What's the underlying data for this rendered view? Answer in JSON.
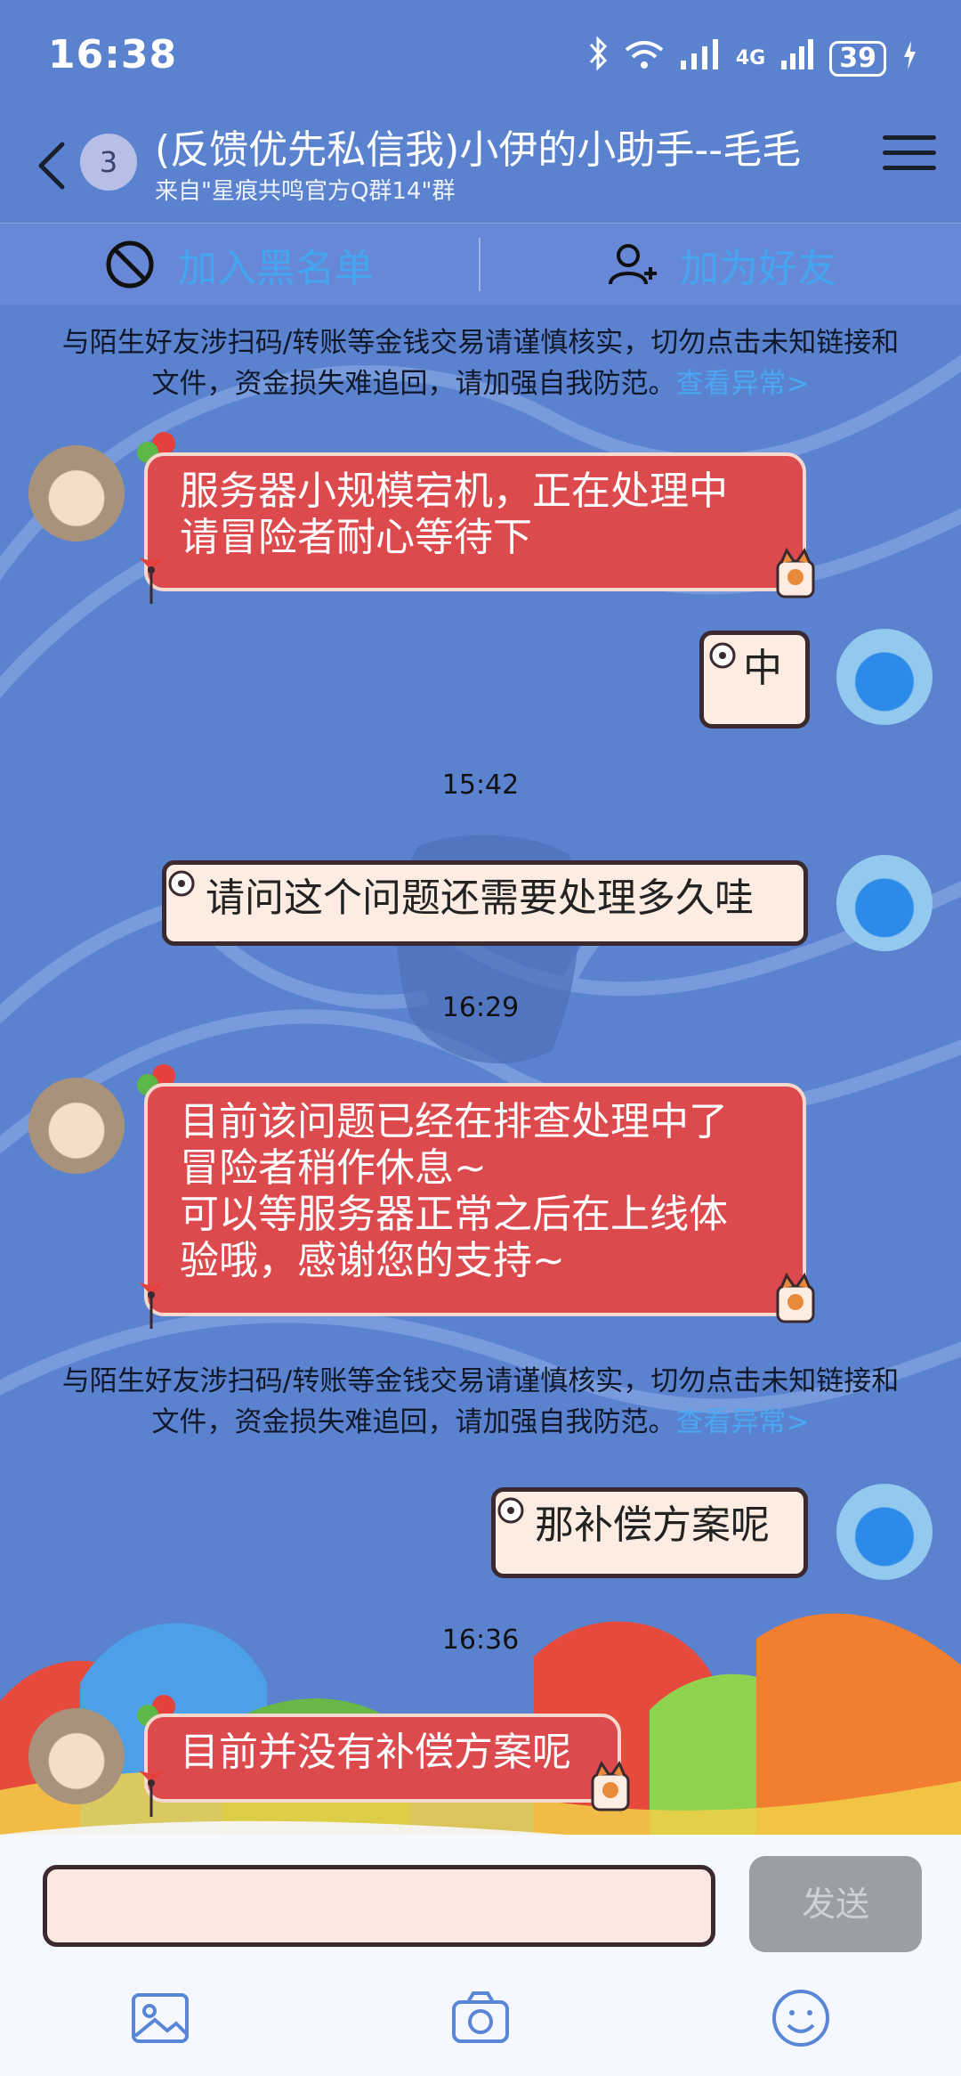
{
  "status_bar": {
    "time": "16:38",
    "network": "4G",
    "battery": "39"
  },
  "header": {
    "unread_count": "3",
    "title": "(反馈优先私信我)小伊的小助手--毛毛",
    "subtitle": "来自\"星痕共鸣官方Q群14\"群"
  },
  "actions": {
    "block_label": "加入黑名单",
    "add_friend_label": "加为好友"
  },
  "notice": {
    "text": "与陌生好友涉扫码/转账等金钱交易请谨慎核实，切勿点击未知链接和文件，资金损失难追回，请加强自我防范。",
    "link": "查看异常>"
  },
  "messages": [
    {
      "side": "left",
      "text": "服务器小规模宕机，正在处理中\n请冒险者耐心等待下"
    },
    {
      "side": "right",
      "text": "中"
    },
    {
      "side": "right",
      "text": "请问这个问题还需要处理多久哇"
    },
    {
      "side": "left",
      "text": "目前该问题已经在排查处理中了\n冒险者稍作休息~\n可以等服务器正常之后在上线体\n验哦，感谢您的支持~"
    },
    {
      "side": "right",
      "text": "那补偿方案呢"
    },
    {
      "side": "left",
      "text": "目前并没有补偿方案呢"
    }
  ],
  "timestamps": [
    "15:42",
    "16:29",
    "16:36"
  ],
  "input": {
    "send_label": "发送"
  },
  "colors": {
    "background": "#5a82cf",
    "left_bubble": "#dc4a4e",
    "right_bubble": "#fcece2",
    "link": "#4aa8f2"
  }
}
